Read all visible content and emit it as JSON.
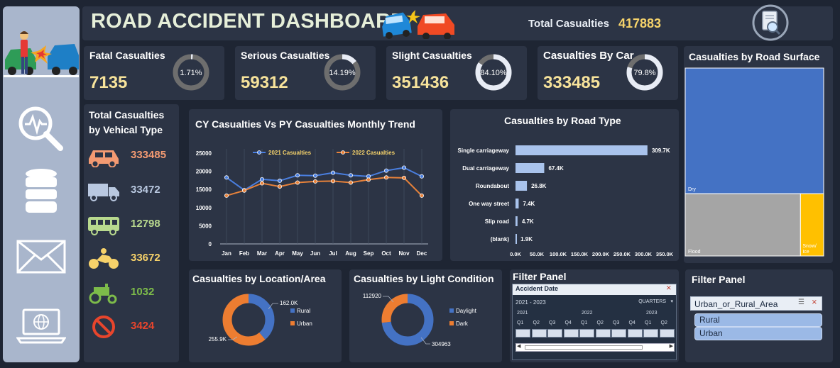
{
  "header": {
    "title": "ROAD ACCIDENT DASHBOARD",
    "total_label": "Total Casualties",
    "total_value": "417883"
  },
  "kpis": [
    {
      "label": "Fatal Casualties",
      "value": "7135",
      "pct_label": "1.71%",
      "pct": 1.71
    },
    {
      "label": "Serious Casualties",
      "value": "59312",
      "pct_label": "14.19%",
      "pct": 14.19
    },
    {
      "label": "Slight Casualties",
      "value": "351436",
      "pct_label": "84.10%",
      "pct": 84.1
    },
    {
      "label": "Casualties By Car",
      "value": "333485",
      "pct_label": "79.8%",
      "pct": 79.8
    }
  ],
  "vehicle": {
    "title_line1": "Total Casualties",
    "title_line2": "by Vehical Type",
    "items": [
      {
        "icon": "car-icon",
        "value": "333485",
        "color": "#f39a72"
      },
      {
        "icon": "truck-icon",
        "value": "33472",
        "color": "#b9c8e0"
      },
      {
        "icon": "bus-icon",
        "value": "12798",
        "color": "#b8d98e"
      },
      {
        "icon": "motorbike-icon",
        "value": "33672",
        "color": "#f7d26a"
      },
      {
        "icon": "tractor-icon",
        "value": "1032",
        "color": "#7dbb4a"
      },
      {
        "icon": "no-entry-icon",
        "value": "3424",
        "color": "#e8452c"
      }
    ]
  },
  "chart_data": [
    {
      "type": "line",
      "title": "CY Casualties Vs PY Casualties Monthly Trend",
      "categories": [
        "Jan",
        "Feb",
        "Mar",
        "Apr",
        "May",
        "Jun",
        "Jul",
        "Aug",
        "Sep",
        "Oct",
        "Nov",
        "Dec"
      ],
      "ylim": [
        0,
        25000
      ],
      "yticks": [
        "0",
        "5000",
        "10000",
        "15000",
        "20000",
        "25000"
      ],
      "legend": "top",
      "series": [
        {
          "name": "2021 Casualties",
          "color": "#4a7fe0",
          "values": [
            18300,
            14800,
            17800,
            17400,
            18900,
            18800,
            19600,
            18900,
            18600,
            20200,
            21000,
            18600
          ]
        },
        {
          "name": "2022 Casualties",
          "color": "#e8823a",
          "values": [
            13300,
            14700,
            16700,
            15800,
            16900,
            17200,
            17300,
            16900,
            17700,
            18300,
            18200,
            13300
          ]
        }
      ]
    },
    {
      "type": "bar",
      "orientation": "horizontal",
      "title": "Casualties by Road Type",
      "categories": [
        "Single carriageway",
        "Dual carriageway",
        "Roundabout",
        "One way street",
        "Slip road",
        "(blank)"
      ],
      "values": [
        309700,
        67400,
        26800,
        7400,
        4700,
        1900
      ],
      "value_labels": [
        "309.7K",
        "67.4K",
        "26.8K",
        "7.4K",
        "4.7K",
        "1.9K"
      ],
      "xlim": [
        0,
        350000
      ],
      "xticks": [
        "0.0K",
        "50.0K",
        "100.0K",
        "150.0K",
        "200.0K",
        "250.0K",
        "300.0K",
        "350.0K"
      ]
    },
    {
      "type": "treemap",
      "title": "Casualties by Road Surface",
      "categories": [
        "Dry",
        "Flood",
        "Snow/Ice"
      ],
      "values": [
        279445,
        115261,
        23177
      ],
      "colors": [
        "#4472c4",
        "#a5a5a5",
        "#ffc000"
      ]
    },
    {
      "type": "pie",
      "title": "Casualties by Location/Area",
      "categories": [
        "Rural",
        "Urban"
      ],
      "values": [
        162000,
        255900
      ],
      "value_labels": [
        "162.0K",
        "255.9K"
      ],
      "colors": [
        "#4472c4",
        "#ed7d31"
      ],
      "legend": "right"
    },
    {
      "type": "pie",
      "title": "Casualties by Light Condition",
      "categories": [
        "Daylight",
        "Dark"
      ],
      "values": [
        304963,
        112920
      ],
      "value_labels": [
        "304963",
        "112920"
      ],
      "colors": [
        "#4472c4",
        "#ed7d31"
      ],
      "legend": "right"
    }
  ],
  "timeline": {
    "title": "Filter Panel",
    "header": "Accident Date",
    "range": "2021 - 2023",
    "level": "QUARTERS",
    "years": [
      "2021",
      "2022",
      "2023"
    ],
    "quarters": [
      "Q1",
      "Q2",
      "Q3",
      "Q4",
      "Q1",
      "Q2",
      "Q3",
      "Q4",
      "Q1",
      "Q2"
    ]
  },
  "slicer": {
    "title": "Filter Panel",
    "header": "Urban_or_Rural_Area",
    "items": [
      "Rural",
      "Urban"
    ]
  }
}
